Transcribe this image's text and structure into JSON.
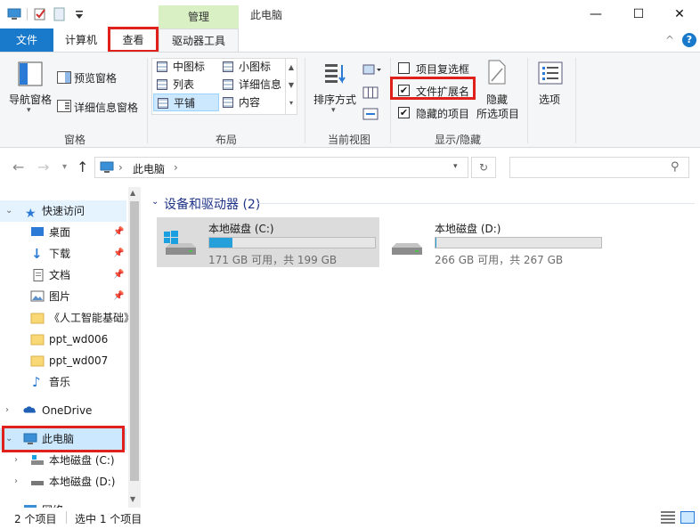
{
  "window": {
    "title": "此电脑",
    "context_tab": "管理",
    "minimize": "—",
    "maximize": "☐",
    "close": "✕"
  },
  "tabs": {
    "file": "文件",
    "computer": "计算机",
    "view": "查看",
    "drive_tools": "驱动器工具",
    "collapse": "^",
    "help": "?"
  },
  "ribbon": {
    "pane": {
      "nav_pane": "导航窗格",
      "preview_pane": "预览窗格",
      "details_pane": "详细信息窗格",
      "group": "窗格"
    },
    "layout": {
      "medium_icons": "中图标",
      "small_icons": "小图标",
      "list": "列表",
      "details": "详细信息",
      "tiles": "平铺",
      "content": "内容",
      "group": "布局"
    },
    "current_view": {
      "sort_by": "排序方式",
      "group": "当前视图"
    },
    "show_hide": {
      "item_checkboxes": "项目复选框",
      "item_checkboxes_checked": false,
      "file_extensions": "文件扩展名",
      "file_extensions_checked": true,
      "hidden_items": "隐藏的项目",
      "hidden_items_checked": true,
      "hide_selected": "隐藏",
      "hide_selected_2": "所选项目",
      "group": "显示/隐藏"
    },
    "options": "选项"
  },
  "address": {
    "path": "此电脑",
    "sep": "›"
  },
  "nav": {
    "quick_access": "快速访问",
    "desktop": "桌面",
    "downloads": "下载",
    "documents": "文档",
    "pictures": "图片",
    "folder_ai": "《人工智能基础》",
    "folder_ppt6": "ppt_wd006",
    "folder_ppt7": "ppt_wd007",
    "music": "音乐",
    "onedrive": "OneDrive",
    "this_pc": "此电脑",
    "drive_c": "本地磁盘 (C:)",
    "drive_d": "本地磁盘 (D:)",
    "network": "网络"
  },
  "content": {
    "section": "设备和驱动器 (2)",
    "drives": [
      {
        "name": "本地磁盘 (C:)",
        "info": "171 GB 可用，共 199 GB",
        "used_fraction": 0.14
      },
      {
        "name": "本地磁盘 (D:)",
        "info": "266 GB 可用，共 267 GB",
        "used_fraction": 0.004
      }
    ]
  },
  "status": {
    "count": "2 个项目",
    "selected": "选中 1 个项目"
  },
  "colors": {
    "accent": "#1979ca",
    "highlight_box": "#e0201b",
    "drive_bar": "#26a0da",
    "context_tab": "#d8f0c4",
    "selected_item": "#cce8ff"
  }
}
